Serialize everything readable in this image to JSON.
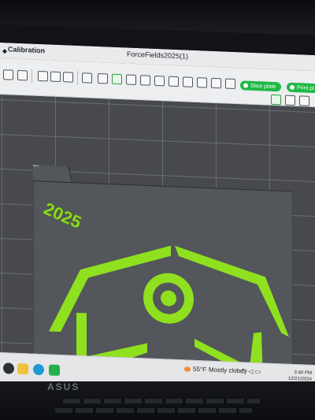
{
  "app": {
    "menu_label": "Calibration",
    "window_title": "ForceFields2025(1)"
  },
  "toolbar": {
    "slice_label": "Slice plate",
    "print_label": "Print pl"
  },
  "model": {
    "text": "2025",
    "color": "#8fe01f",
    "plate_color": "#53565b"
  },
  "taskbar": {
    "weather_temp": "55°F",
    "weather_text": "Mostly cloudy",
    "clock_time": "2:40 PM",
    "clock_date": "12/21/2024"
  },
  "device": {
    "brand": "ASUS"
  }
}
